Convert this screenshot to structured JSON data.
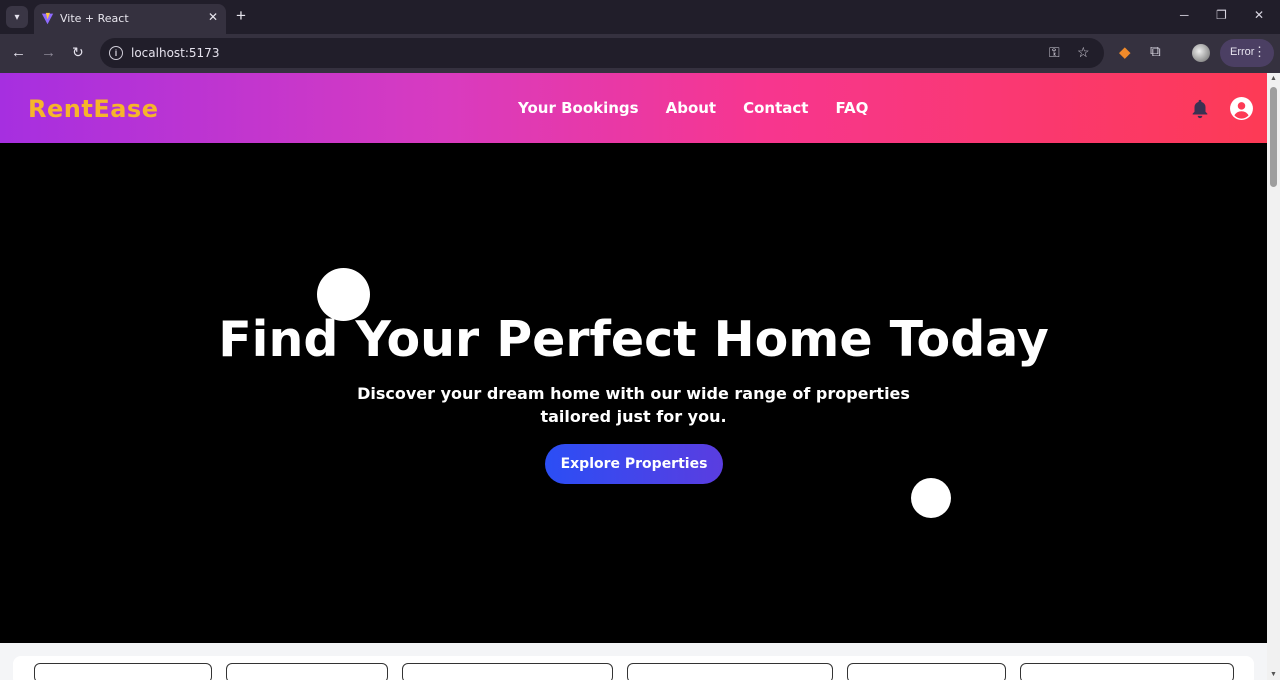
{
  "browser": {
    "tab_title": "Vite + React",
    "url": "localhost:5173",
    "error_label": "Error"
  },
  "navbar": {
    "brand": "RentEase",
    "links": [
      "Your Bookings",
      "About",
      "Contact",
      "FAQ"
    ],
    "colors": {
      "gradient_start": "#a62fe0",
      "gradient_end": "#fd3a55",
      "brand": "#f6b52b"
    }
  },
  "hero": {
    "title": "Find Your Perfect Home Today",
    "subtitle": "Discover your dream home with our wide range of properties tailored just for you.",
    "cta_label": "Explore Properties"
  },
  "icons": {
    "notifications": "bell-icon",
    "account": "user-circle-icon"
  }
}
